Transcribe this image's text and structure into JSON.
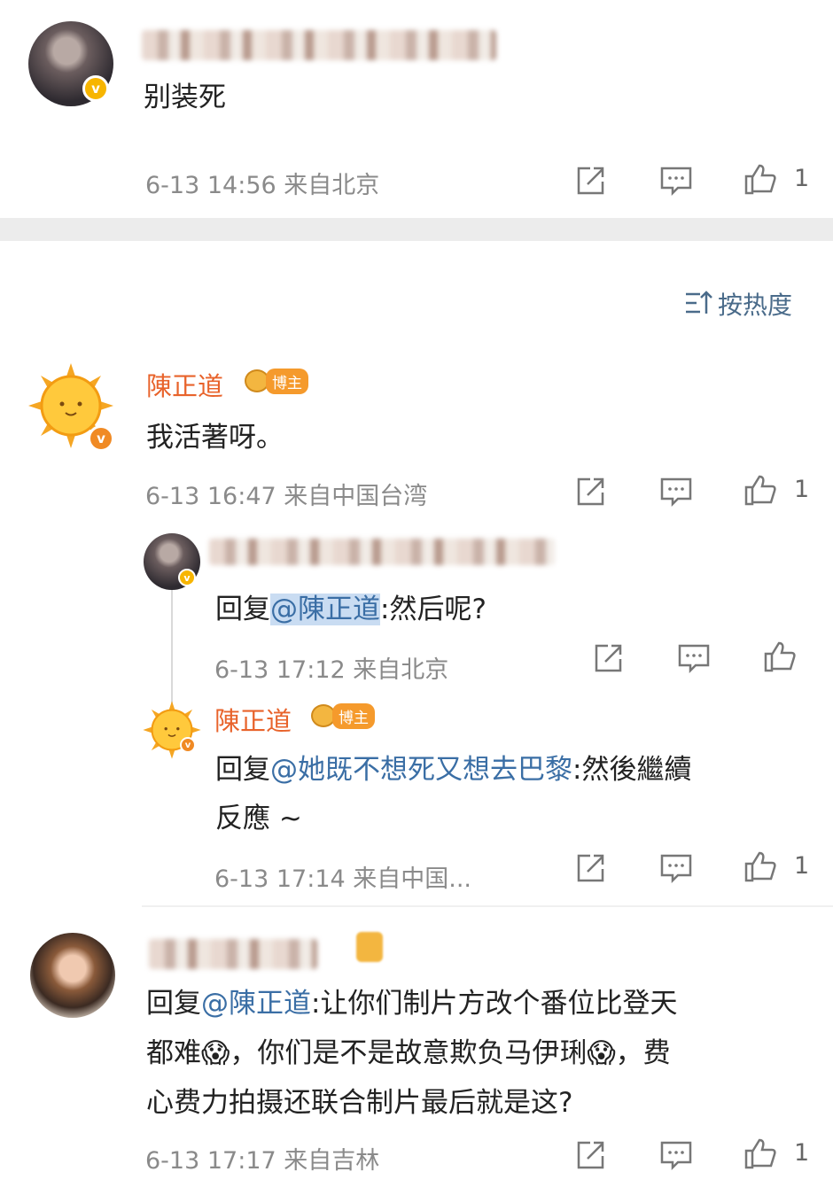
{
  "comment1": {
    "text": "别装死",
    "meta": "6-13 14:56  来自北京",
    "like_count": "1"
  },
  "sort": {
    "label": "按热度"
  },
  "comment2": {
    "author": "陳正道",
    "tag": "博主",
    "text": "我活著呀。",
    "meta": "6-13 16:47  来自中国台湾",
    "like_count": "1"
  },
  "reply1": {
    "prefix": "回复",
    "mention": "@陳正道",
    "rest": ":然后呢?",
    "meta": "6-13 17:12  来自北京"
  },
  "reply2": {
    "author": "陳正道",
    "tag": "博主",
    "prefix": "回复",
    "mention": "@她既不想死又想去巴黎",
    "rest": ":然後繼續",
    "line2": "反應 ~",
    "meta": "6-13 17:14  来自中国...",
    "like_count": "1"
  },
  "comment3": {
    "prefix": "回复",
    "mention": "@陳正道",
    "rest": ":让你们制片方改个番位比登天",
    "line2": "都难😱，你们是不是故意欺负马伊琍😱，费",
    "line3": "心费力拍摄还联合制片最后就是这?",
    "meta": "6-13 17:17  来自吉林",
    "like_count": "1"
  },
  "icons": [
    "share-icon",
    "comment-icon",
    "like-icon",
    "sort-icon",
    "verified-badge-icon"
  ]
}
